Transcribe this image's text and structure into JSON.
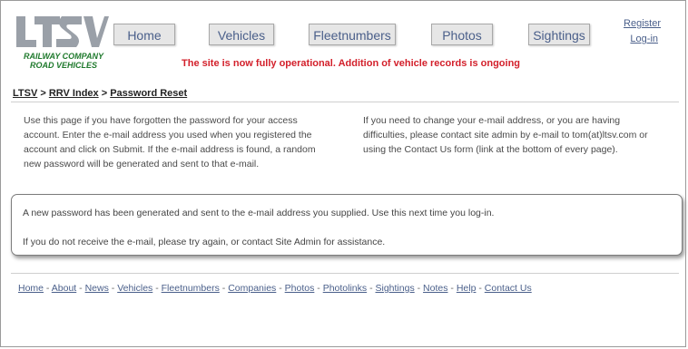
{
  "logo": {
    "text": "LTSV",
    "subtitle_line1": "RAILWAY COMPANY",
    "subtitle_line2": "ROAD VEHICLES",
    "color": "#9aa0a8"
  },
  "nav": [
    "Home",
    "Vehicles",
    "Fleetnumbers",
    "Photos",
    "Sightings"
  ],
  "account": {
    "register": "Register",
    "login": "Log-in"
  },
  "notice": "The site is now fully operational. Addition of vehicle records is ongoing",
  "breadcrumb": {
    "item1": "LTSV",
    "sep": ">",
    "item2": "RRV Index",
    "current": "Password Reset"
  },
  "intro": {
    "left": [
      "Use this page if you have forgotten the password for your access",
      "account. Enter the e-mail address you used when you registered the",
      "account and click on Submit. If the e-mail address is found, a random",
      "new password will be generated and sent to that e-mail."
    ],
    "right": [
      "If you need to change your e-mail address, or you are having",
      "difficulties, please contact site admin by e-mail to tom(at)ltsv.com or",
      "using the Contact Us form (link at the bottom of every page)."
    ]
  },
  "message": {
    "line1": "A new password has been generated and sent to the e-mail address you supplied. Use this next time you log-in.",
    "line2": "If you do not receive the e-mail, please try again, or contact Site Admin for assistance."
  },
  "footer_links": [
    "Home",
    "About",
    "News",
    "Vehicles",
    "Fleetnumbers",
    "Companies",
    "Photos",
    "Photolinks",
    "Sightings",
    "Notes",
    "Help",
    "Contact Us"
  ],
  "footer_sep": " - "
}
